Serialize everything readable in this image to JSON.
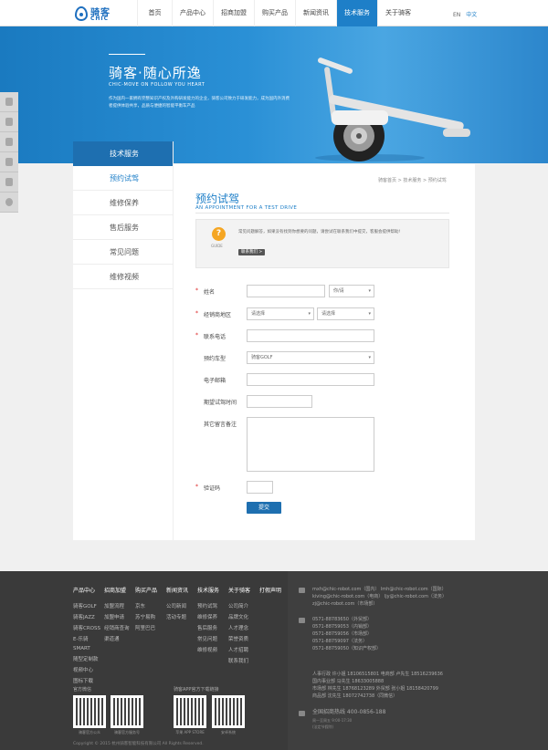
{
  "header": {
    "logo_cn": "骑客",
    "logo_en": "CHIC",
    "nav": [
      "首页",
      "产品中心",
      "招商加盟",
      "购买产品",
      "新闻资讯",
      "技术服务",
      "关于骑客"
    ],
    "active_nav": 5,
    "lang_en": "EN",
    "lang_zh": "中文"
  },
  "banner": {
    "title": "骑客·随心所逸",
    "subtitle": "CHIC-MOVE ON FOLLOW YOU HEART",
    "desc": "作为国内一家拥有完整知识产权及外购研发能力的企业，骑客公司致力于研发能力，成为国内外消费者提供体验共享，品质与便捷的智能平衡车产品"
  },
  "sidebar": {
    "head": "技术服务",
    "items": [
      "预约试驾",
      "维修保养",
      "售后服务",
      "常见问题",
      "维修视频"
    ]
  },
  "crumb": "骑客首页 > 技术服务 > 预约试驾",
  "page_title": "预约试驾",
  "page_subtitle": "AN APPOINTMENT FOR A TEST DRIVE",
  "notice": {
    "guide": "GUIDE",
    "text": "常见问题解答，如果没有找到你想要的问题，请尝试在联系我们中提交，客服会提供帮助!",
    "button": "联系我们 >"
  },
  "form": {
    "name_label": "姓名",
    "title_select": "你/请",
    "dealer_label": "经销商地区",
    "prov_placeholder": "请选择",
    "city_placeholder": "请选择",
    "phone_label": "联系电话",
    "model_label": "预约车型",
    "model_value": "骑客GOLF",
    "email_label": "电子邮箱",
    "time_label": "期望试驾时间",
    "note_label": "其它留言备注",
    "code_label": "验证码",
    "submit": "提交"
  },
  "footer": {
    "cols": [
      {
        "h": "产品中心",
        "l": [
          "骑客GOLF",
          "骑客JAZZ",
          "骑客CROSS",
          "E-乐骑",
          "SMART",
          "随型定制款",
          "视频中心",
          "图标下载"
        ]
      },
      {
        "h": "招商加盟",
        "l": [
          "加盟流程",
          "加盟申请",
          "经销商查询",
          "渠道通"
        ]
      },
      {
        "h": "购买产品",
        "l": [
          "京东",
          "苏宁易购",
          "阿里巴巴"
        ]
      },
      {
        "h": "新闻资讯",
        "l": [
          "公司新闻",
          "活动专题"
        ]
      },
      {
        "h": "技术服务",
        "l": [
          "预约试驾",
          "维修保养",
          "售后服务",
          "常见问题",
          "维修视频"
        ]
      },
      {
        "h": "关于骑客",
        "l": [
          "公司简介",
          "品牌文化",
          "人才理念",
          "荣誉资质",
          "人才招聘",
          "联系我们"
        ]
      },
      {
        "h": "打假声明",
        "l": []
      }
    ],
    "wechat_title": "官方微信",
    "app_title": "骑客APP官方下载链接",
    "qr_labels": [
      "骑客官方公众",
      "骑客官方服务号",
      "苹果 APP STORE",
      "安卓系统"
    ],
    "emails": [
      "mxh@chic-robot.com（国内）  lmh@chic-robot.com（国际）",
      "kiving@chic-robot.com（电商）  ljy@chic-robot.com（法务）",
      "zj@chic-robot.com（市场部）"
    ],
    "phones": [
      "0571-88783650（外贸部）",
      "0571-88759053（内销部）",
      "0571-88759056（市场部）",
      "0571-88759097（法务）",
      "0571-88759050（知识产权部）"
    ],
    "contacts": [
      "人事行政 许小姐 18106515801    电商部 卢先生 18516239636",
      "国内事业部 马先生 18633005888",
      "市场部 林先生 18768123289    外贸部 张小姐 18158420799",
      "商品部 沈先生 18072742738（同微信）"
    ],
    "hotline": "全国招商热线 400-0856-188",
    "hours": "周一至周五 9:00-17:30",
    "hours2": "(法定节假除)",
    "copyright": "Copyright © 2015 杭州骑客智能科技有限公司 All Rights Reserved."
  }
}
